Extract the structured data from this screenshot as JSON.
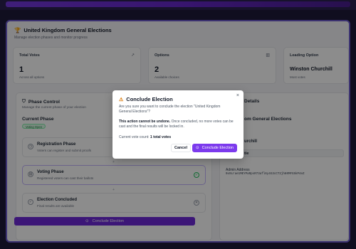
{
  "header": {
    "title": "United Kingdom General Elections",
    "subtitle": "Manage election phases and monitor progress"
  },
  "stats": {
    "total_votes": {
      "label": "Total Votes",
      "value": "1",
      "sub": "Across all options"
    },
    "options": {
      "label": "Options",
      "value": "2",
      "sub": "Available choices"
    },
    "leading": {
      "label": "Leading Option",
      "value": "Winston Churchill",
      "sub": "Most votes"
    }
  },
  "phase_control": {
    "title": "Phase Control",
    "subtitle": "Manage the current phase of your election",
    "current_label": "Current Phase",
    "current_badge": "Voting Open",
    "phases": [
      {
        "name": "Registration Phase",
        "desc": "Voters can register and submit proofs"
      },
      {
        "name": "Voting Phase",
        "desc": "Registered voters can cast their ballots"
      },
      {
        "name": "Election Concluded",
        "desc": "Final results are available"
      }
    ],
    "conclude_button": "Conclude Election"
  },
  "election_details": {
    "title": "Details",
    "name": "om General Elections",
    "winner": "urchill",
    "tie": "tie",
    "admin_label": "Admin Address",
    "admin_address": "0x9Lrae1MEYPaRpsR73afl6y4G3cCT2jh80MFG5kP4eZ"
  },
  "modal": {
    "title": "Conclude Election",
    "question": "Are you sure you want to conclude the election \"United Kingdom General Elections\"?",
    "warning_bold": "This action cannot be undone.",
    "warning_rest": " Once concluded, no more votes can be cast and the final results will be locked in.",
    "count_label": "Current vote count: ",
    "count_value": "1 total votes",
    "cancel": "Cancel",
    "confirm": "Conclude Election",
    "close": "×"
  },
  "icons": {
    "trophy": "trophy-icon",
    "trend": "trend-icon",
    "chart": "bar-chart-icon",
    "shield": "shield-icon",
    "warning": "warning-icon"
  },
  "colors": {
    "accent": "#7c3aed",
    "accent_dark": "#6d28d9",
    "success": "#22c55e",
    "warning": "#d97706"
  }
}
